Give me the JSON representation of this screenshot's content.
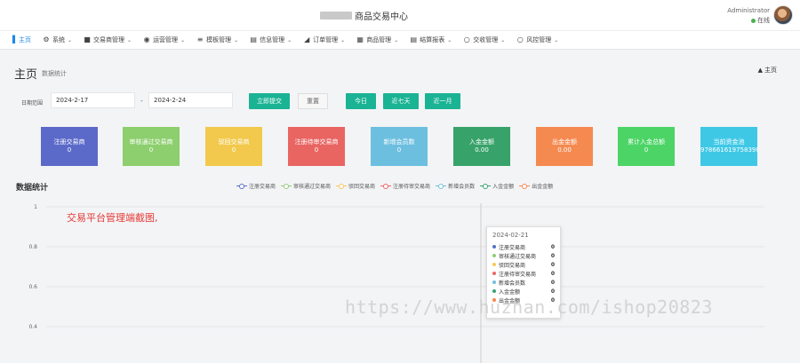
{
  "header": {
    "app_title": "商品交易中心",
    "user_name": "Administrator",
    "user_status": "在线"
  },
  "nav": [
    {
      "label": "主页",
      "icon": "bar-chart-icon",
      "active": true,
      "has_menu": false
    },
    {
      "label": "系统",
      "icon": "gear-icon",
      "has_menu": true
    },
    {
      "label": "交易商管理",
      "icon": "book-icon",
      "has_menu": true
    },
    {
      "label": "运营管理",
      "icon": "user-circle-icon",
      "has_menu": true
    },
    {
      "label": "模板管理",
      "icon": "list-icon",
      "has_menu": true
    },
    {
      "label": "信息管理",
      "icon": "book-open-icon",
      "has_menu": true
    },
    {
      "label": "订单管理",
      "icon": "area-chart-icon",
      "has_menu": true
    },
    {
      "label": "商品管理",
      "icon": "calendar-icon",
      "has_menu": true
    },
    {
      "label": "结算报表",
      "icon": "table-icon",
      "has_menu": true
    },
    {
      "label": "交收管理",
      "icon": "circle-icon",
      "has_menu": true
    },
    {
      "label": "风控管理",
      "icon": "circle-icon",
      "has_menu": true
    }
  ],
  "page": {
    "title": "主页",
    "subtitle": "数据统计",
    "home_link": "主页"
  },
  "filter": {
    "date_label": "日期范围",
    "start_date": "2024-2-17",
    "separator": "-",
    "end_date": "2024-2-24",
    "submit": "立即提交",
    "reset": "重置",
    "today": "今日",
    "last7": "近七天",
    "last_month": "近一月"
  },
  "cards": [
    {
      "label": "注册交易商",
      "value": "0",
      "color": "#5b6ac9"
    },
    {
      "label": "审核通过交易商",
      "value": "0",
      "color": "#8dcf6e"
    },
    {
      "label": "驳回交易商",
      "value": "0",
      "color": "#f2c94c"
    },
    {
      "label": "注册待审交易商",
      "value": "0",
      "color": "#e96562"
    },
    {
      "label": "新增会员数",
      "value": "0",
      "color": "#6dbfe0"
    },
    {
      "label": "入金金额",
      "value": "0.00",
      "color": "#37a36a"
    },
    {
      "label": "出金金额",
      "value": "0.00",
      "color": "#f58a51"
    },
    {
      "label": "累计入金总额",
      "value": "0",
      "color": "#4cd466"
    },
    {
      "label": "当前资金池",
      "value": "9786616197583984.3",
      "color": "#3fc8e6"
    }
  ],
  "chart": {
    "title": "数据统计",
    "annotation": "交易平台管理端截图,",
    "watermark": "https://www.huzhan.com/ishop20823"
  },
  "chart_data": {
    "type": "line",
    "ylim": [
      0.4,
      1
    ],
    "yticks": [
      1,
      0.8,
      0.6,
      0.4
    ],
    "grid": true,
    "legend_position": "top",
    "series": [
      {
        "name": "注册交易商",
        "color": "#5470c6"
      },
      {
        "name": "审核通过交易商",
        "color": "#91cc75"
      },
      {
        "name": "驳回交易商",
        "color": "#fac858"
      },
      {
        "name": "注册待审交易商",
        "color": "#ee6666"
      },
      {
        "name": "新增会员数",
        "color": "#73c0de"
      },
      {
        "name": "入金金额",
        "color": "#3ba272"
      },
      {
        "name": "出金金额",
        "color": "#fc8452"
      }
    ],
    "tooltip": {
      "date": "2024-02-21",
      "rows": [
        {
          "label": "注册交易商",
          "value": "0",
          "color": "#5470c6"
        },
        {
          "label": "审核通过交易商",
          "value": "0",
          "color": "#91cc75"
        },
        {
          "label": "驳回交易商",
          "value": "0",
          "color": "#fac858"
        },
        {
          "label": "注册待审交易商",
          "value": "0",
          "color": "#ee6666"
        },
        {
          "label": "新增会员数",
          "value": "0",
          "color": "#73c0de"
        },
        {
          "label": "入金金额",
          "value": "0",
          "color": "#3ba272"
        },
        {
          "label": "出金金额",
          "value": "0",
          "color": "#fc8452"
        }
      ]
    }
  }
}
